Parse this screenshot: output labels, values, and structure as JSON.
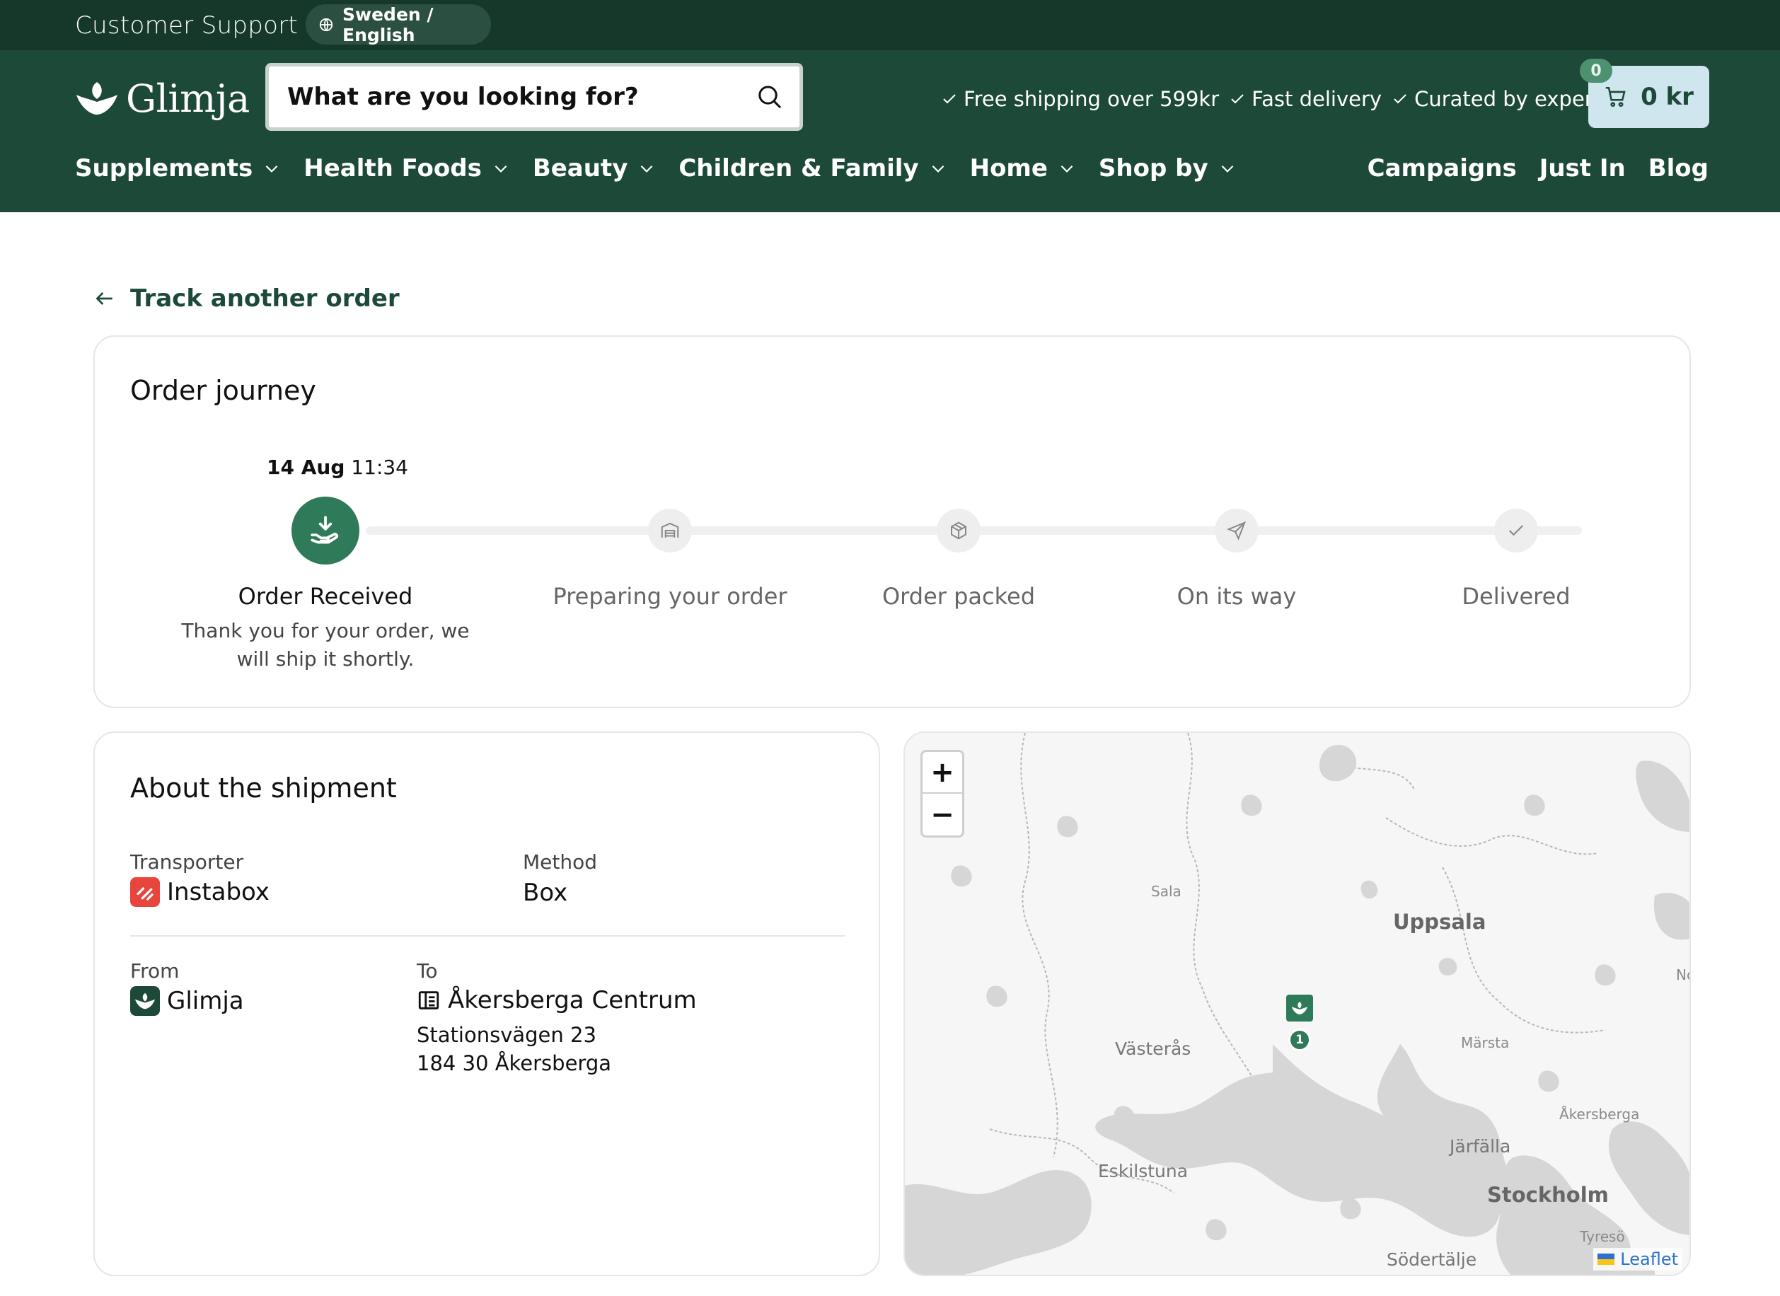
{
  "topbar": {
    "support_label": "Customer Support",
    "language_label": "Sweden / English"
  },
  "header": {
    "logo_text": "Glimja",
    "search_placeholder": "What are you looking for?",
    "usps": [
      "Free shipping over 599kr",
      "Fast delivery",
      "Curated by experts"
    ],
    "cart_count": "0",
    "cart_total": "0 kr"
  },
  "nav": {
    "left": [
      {
        "label": "Supplements"
      },
      {
        "label": "Health Foods"
      },
      {
        "label": "Beauty"
      },
      {
        "label": "Children & Family"
      },
      {
        "label": "Home"
      },
      {
        "label": "Shop by"
      }
    ],
    "right": [
      {
        "label": "Campaigns"
      },
      {
        "label": "Just In"
      },
      {
        "label": "Blog"
      }
    ]
  },
  "back_link": "Track another order",
  "journey": {
    "title": "Order journey",
    "date_day": "14 Aug",
    "date_time": "11:34",
    "steps": [
      {
        "label": "Order Received",
        "icon": "hand-download-icon",
        "active": true,
        "description": "Thank you for your order, we will ship it shortly."
      },
      {
        "label": "Preparing your order",
        "icon": "warehouse-icon",
        "active": false
      },
      {
        "label": "Order packed",
        "icon": "package-icon",
        "active": false
      },
      {
        "label": "On its way",
        "icon": "send-icon",
        "active": false
      },
      {
        "label": "Delivered",
        "icon": "check-icon",
        "active": false
      }
    ]
  },
  "shipment": {
    "title": "About the shipment",
    "transporter_label": "Transporter",
    "transporter_value": "Instabox",
    "method_label": "Method",
    "method_value": "Box",
    "from_label": "From",
    "from_value": "Glimja",
    "to_label": "To",
    "to_name": "Åkersberga Centrum",
    "to_street": "Stationsvägen 23",
    "to_city": "184 30 Åkersberga"
  },
  "map": {
    "zoom_in": "+",
    "zoom_out": "−",
    "labels": [
      "Sala",
      "Uppsala",
      "Västerås",
      "Märsta",
      "Åkersberga",
      "Järfälla",
      "Eskilstuna",
      "Stockholm",
      "Tyresö",
      "Södertälje",
      "No"
    ],
    "marker_count": "1",
    "attribution": "Leaflet"
  },
  "colors": {
    "topbar": "#15382a",
    "header": "#1d4a38",
    "accent": "#2f7a58",
    "cart": "#cfe6ee",
    "instabox": "#e8453c"
  }
}
